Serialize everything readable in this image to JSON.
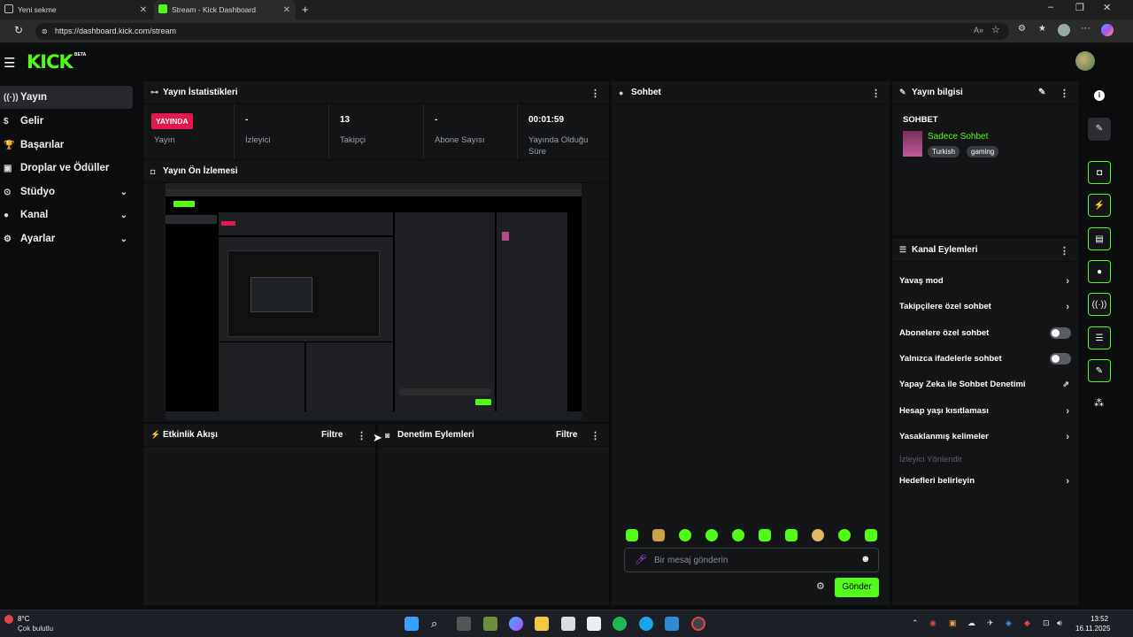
{
  "browser": {
    "tabs": [
      {
        "label": "Yeni sekme",
        "active": false
      },
      {
        "label": "Stream - Kick Dashboard",
        "active": true
      }
    ],
    "url": "https://dashboard.kick.com/stream"
  },
  "brand": {
    "logo": "KICK",
    "beta": "BETA",
    "accent": "#53fc18"
  },
  "sidebar": {
    "items": [
      {
        "label": "Yayın",
        "icon": "broadcast-icon",
        "active": true,
        "expandable": false
      },
      {
        "label": "Gelir",
        "icon": "dollar-icon",
        "active": false,
        "expandable": false
      },
      {
        "label": "Başarılar",
        "icon": "trophy-icon",
        "active": false,
        "expandable": false
      },
      {
        "label": "Droplar ve Ödüller",
        "icon": "gift-icon",
        "active": false,
        "expandable": false
      },
      {
        "label": "Stüdyo",
        "icon": "camera-icon",
        "active": false,
        "expandable": true
      },
      {
        "label": "Kanal",
        "icon": "user-icon",
        "active": false,
        "expandable": true
      },
      {
        "label": "Ayarlar",
        "icon": "gear-icon",
        "active": false,
        "expandable": true
      }
    ]
  },
  "stats": {
    "title": "Yayın İstatistikleri",
    "live_badge": "YAYINDA",
    "items": [
      {
        "value": "",
        "label": "Yayın"
      },
      {
        "value": "-",
        "label": "İzleyici"
      },
      {
        "value": "13",
        "label": "Takipçi"
      },
      {
        "value": "-",
        "label": "Abone Sayısı"
      },
      {
        "value": "00:01:59",
        "label": "Yayında Olduğu Süre"
      }
    ]
  },
  "preview": {
    "title": "Yayın Ön İzlemesi"
  },
  "activity": {
    "title": "Etkinlik Akışı",
    "filter": "Filtre"
  },
  "moderation": {
    "title": "Denetim Eylemleri",
    "filter": "Filtre"
  },
  "chat": {
    "title": "Sohbet",
    "placeholder": "Bir mesaj gönderin",
    "send": "Gönder"
  },
  "stream_info": {
    "title": "Yayın bilgisi",
    "section": "SOHBET",
    "stream_title": "Sadece Sohbet",
    "tags": [
      "Turkish",
      "gaming"
    ]
  },
  "channel_actions": {
    "title": "Kanal Eylemleri",
    "items": [
      {
        "label": "Yavaş mod",
        "control": "chevron"
      },
      {
        "label": "Takipçilere özel sohbet",
        "control": "chevron"
      },
      {
        "label": "Abonelere özel sohbet",
        "control": "toggle"
      },
      {
        "label": "Yalnızca ifadelerle sohbet",
        "control": "toggle"
      },
      {
        "label": "Yapay Zeka ile Sohbet Denetimi",
        "control": "external"
      },
      {
        "label": "Hesap yaşı kısıtlaması",
        "control": "chevron"
      },
      {
        "label": "Yasaklanmış kelimeler",
        "control": "chevron"
      },
      {
        "label": "İzleyici Yönlendir",
        "control": "none",
        "disabled": true
      },
      {
        "label": "Hedefleri belirleyin",
        "control": "chevron"
      }
    ]
  },
  "taskbar": {
    "weather_temp": "8°C",
    "weather_desc": "Çok bulutlu",
    "time": "13:52",
    "date": "16.11.2025"
  }
}
